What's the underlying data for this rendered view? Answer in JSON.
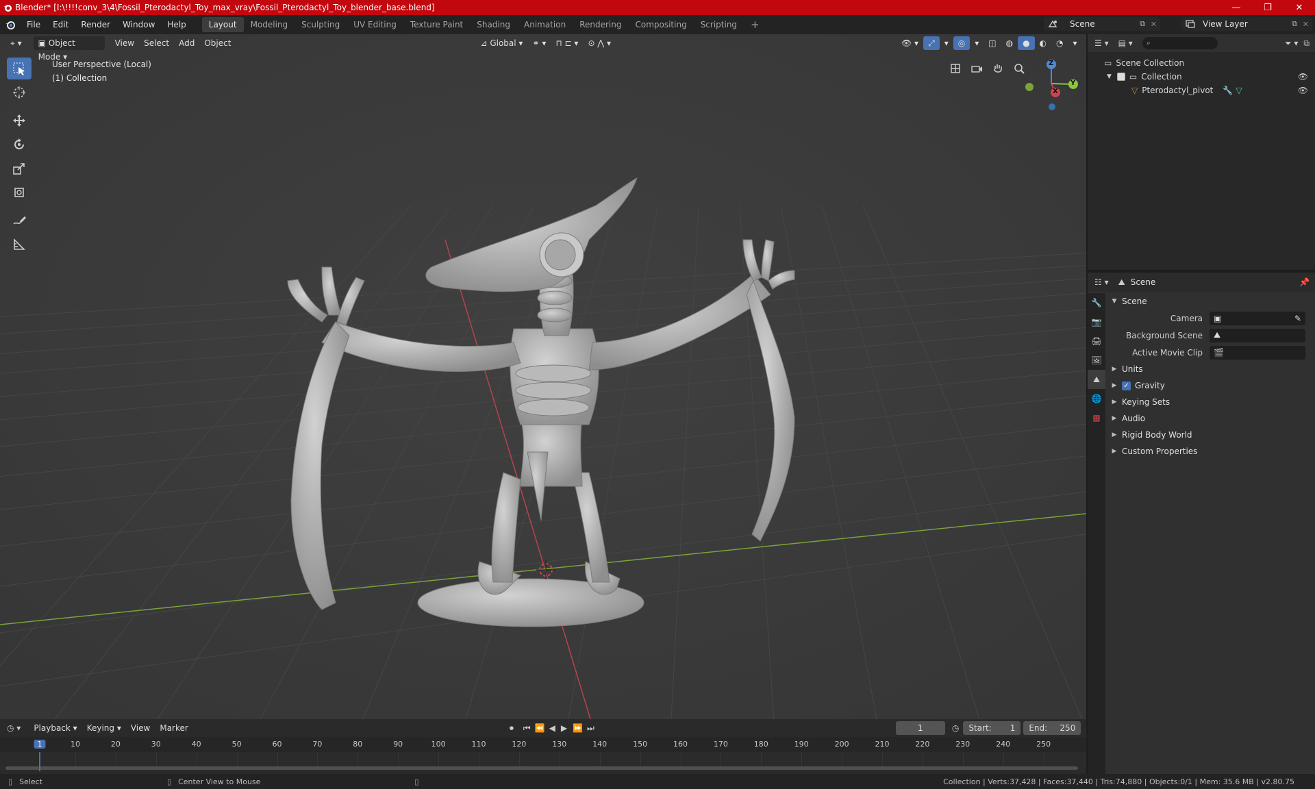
{
  "titlebar": {
    "title": "Blender* [I:\\!!!!conv_3\\4\\Fossil_Pterodactyl_Toy_max_vray\\Fossil_Pterodactyl_Toy_blender_base.blend]",
    "minimize": "—",
    "maximize": "❐",
    "close": "✕"
  },
  "menubar": {
    "items": [
      "File",
      "Edit",
      "Render",
      "Window",
      "Help"
    ],
    "workspaces": [
      "Layout",
      "Modeling",
      "Sculpting",
      "UV Editing",
      "Texture Paint",
      "Shading",
      "Animation",
      "Rendering",
      "Compositing",
      "Scripting"
    ],
    "add_workspace": "+",
    "scene": "Scene",
    "view_layer": "View Layer"
  },
  "viewport": {
    "mode": "Object Mode",
    "menus": [
      "View",
      "Select",
      "Add",
      "Object"
    ],
    "orientation": "Global",
    "perspective_label": "User Perspective (Local)",
    "collection_label": "(1) Collection",
    "gizmo": {
      "z": "Z",
      "y": "Y",
      "x": "X"
    }
  },
  "outliner": {
    "scene_collection": "Scene Collection",
    "collection": "Collection",
    "object": "Pterodactyl_pivot",
    "search_placeholder": ""
  },
  "properties": {
    "header": "Scene",
    "panel_title": "Scene",
    "camera_label": "Camera",
    "background_scene_label": "Background Scene",
    "active_movie_clip_label": "Active Movie Clip",
    "sections": [
      "Units",
      "Gravity",
      "Keying Sets",
      "Audio",
      "Rigid Body World",
      "Custom Properties"
    ]
  },
  "timeline": {
    "menus": [
      "Playback",
      "Keying",
      "View",
      "Marker"
    ],
    "current_frame": "1",
    "start_label": "Start:",
    "start_value": "1",
    "end_label": "End:",
    "end_value": "250",
    "ticks": [
      "1",
      "10",
      "20",
      "30",
      "40",
      "50",
      "60",
      "70",
      "80",
      "90",
      "100",
      "110",
      "120",
      "130",
      "140",
      "150",
      "160",
      "170",
      "180",
      "190",
      "200",
      "210",
      "220",
      "230",
      "240",
      "250"
    ]
  },
  "statusbar": {
    "select": "Select",
    "center_view": "Center View to Mouse",
    "stats": "Collection | Verts:37,428 | Faces:37,440 | Tris:74,880 | Objects:0/1 | Mem: 35.6 MB | v2.80.75"
  },
  "colors": {
    "title_bg": "#c2070e",
    "accent": "#4772b3",
    "x_axis": "#d0434d",
    "y_axis": "#8cc63f",
    "z_axis": "#4a8bd9"
  }
}
